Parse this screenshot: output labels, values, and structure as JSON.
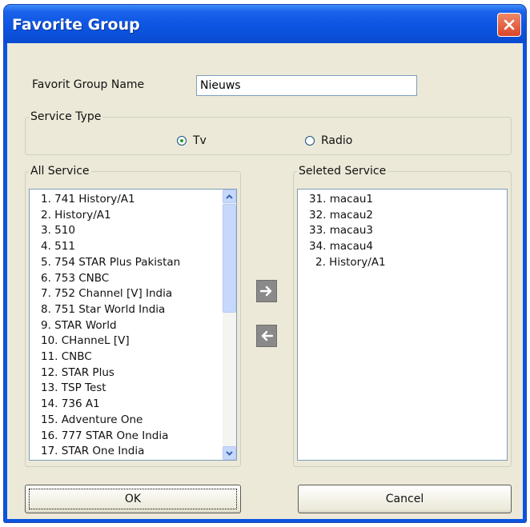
{
  "window": {
    "title": "Favorite Group"
  },
  "form": {
    "name_label": "Favorit Group Name",
    "name_value": "Nieuws"
  },
  "service_type": {
    "legend": "Service Type",
    "options": [
      {
        "label": "Tv",
        "selected": true
      },
      {
        "label": "Radio",
        "selected": false
      }
    ]
  },
  "all_service": {
    "legend": "All Service",
    "items": [
      "1. 741 History/A1",
      "2. History/A1",
      "3. 510",
      "4. 511",
      "5. 754 STAR Plus Pakistan",
      "6. 753 CNBC",
      "7. 752 Channel [V] India",
      "8. 751 Star World India",
      "9. STAR World",
      "10. CHanneL [V]",
      "11. CNBC",
      "12. STAR Plus",
      "13. TSP Test",
      "14. 736 A1",
      "15. Adventure One",
      "16. 777 STAR One India",
      "17. STAR One India"
    ]
  },
  "selected_service": {
    "legend": "Seleted Service",
    "items": [
      "31. macau1",
      "32. macau2",
      "33. macau3",
      "34. macau4",
      "2. History/A1"
    ]
  },
  "buttons": {
    "ok": "OK",
    "cancel": "Cancel"
  },
  "icons": {
    "close": "close-icon",
    "add": "arrow-right-icon",
    "remove": "arrow-left-icon",
    "scroll_up": "scroll-up-icon",
    "scroll_down": "scroll-down-icon"
  },
  "colors": {
    "titlebar": "#0c55e2",
    "dialog_bg": "#ece9d8",
    "close_button": "#d9462a"
  }
}
